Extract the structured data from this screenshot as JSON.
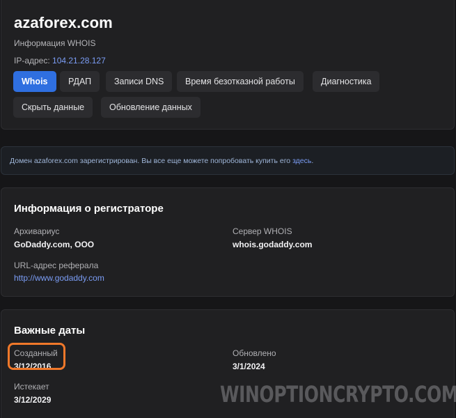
{
  "header": {
    "domain": "azaforex.com",
    "subtitle": "Информация WHOIS",
    "ip_label": "IP-адрес: ",
    "ip_value": "104.21.28.127"
  },
  "tabs": [
    {
      "label": "Whois",
      "active": true
    },
    {
      "label": "РДАП",
      "active": false
    },
    {
      "label": "Записи DNS",
      "active": false
    },
    {
      "label": "Время безотказной работы",
      "active": false
    },
    {
      "label": "Диагностика",
      "active": false
    },
    {
      "label": "Скрыть данные",
      "active": false
    },
    {
      "label": "Обновление данных",
      "active": false
    }
  ],
  "notice": {
    "text": "Домен azaforex.com зарегистрирован. Вы все еще можете попробовать купить его ",
    "link": "здесь",
    "suffix": "."
  },
  "registrar": {
    "title": "Информация о регистраторе",
    "archivist_label": "Архивариус",
    "archivist_value": "GoDaddy.com, ООО",
    "whois_server_label": "Сервер WHOIS",
    "whois_server_value": "whois.godaddy.com",
    "referral_label": "URL-адрес реферала",
    "referral_value": "http://www.godaddy.com"
  },
  "dates": {
    "title": "Важные даты",
    "created_label": "Созданный",
    "created_value": "3/12/2016",
    "updated_label": "Обновлено",
    "updated_value": "3/1/2024",
    "expires_label": "Истекает",
    "expires_value": "3/12/2029"
  },
  "watermark": "WINOPTIONCRYPTO.COM",
  "colors": {
    "background": "#161618",
    "card": "#202022",
    "accent": "#2f6fe0",
    "link": "#7b9df5",
    "highlight": "#f0782a"
  }
}
